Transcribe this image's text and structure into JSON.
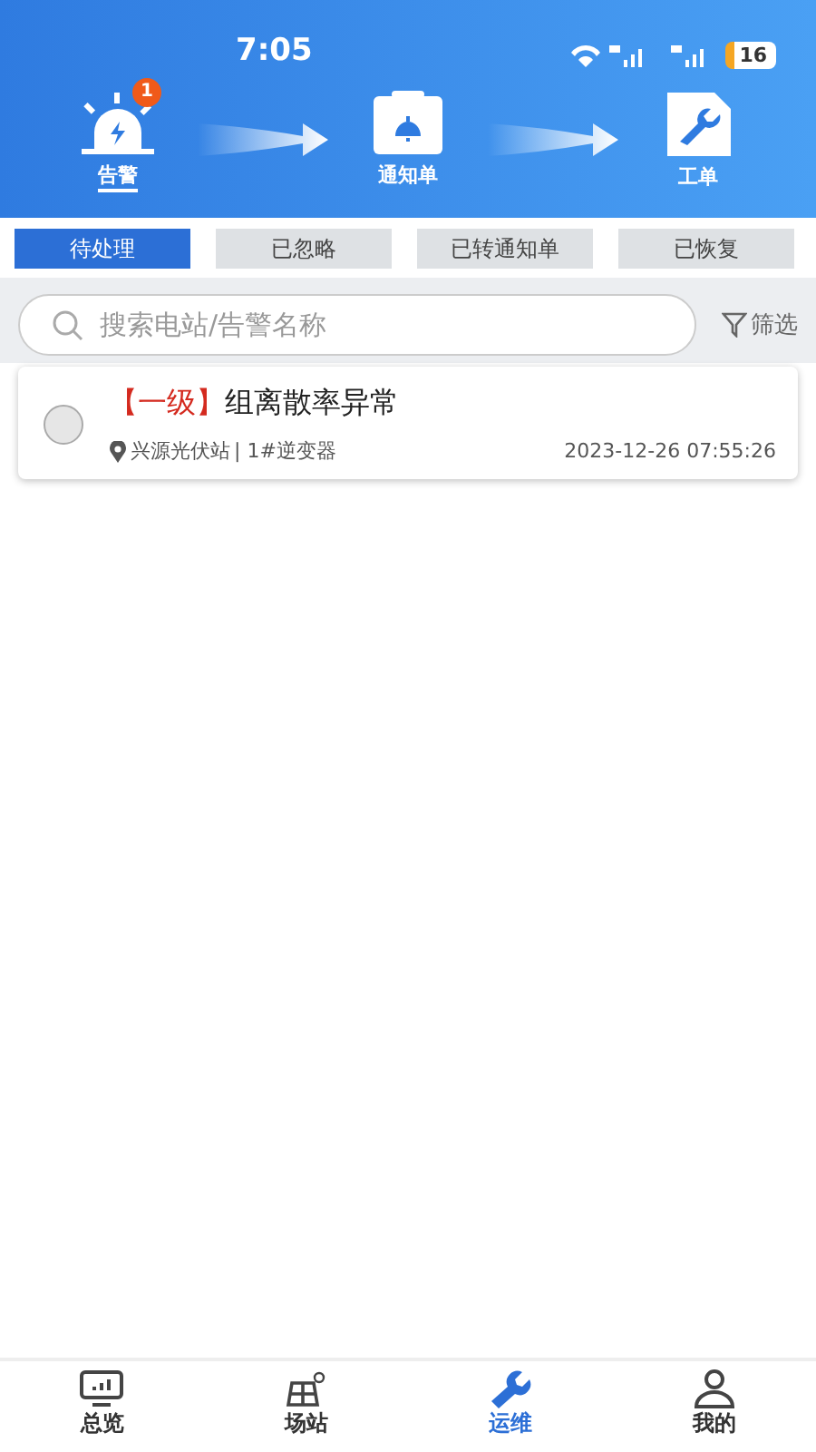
{
  "status_bar": {
    "time": "7:05",
    "battery": "16"
  },
  "flow": [
    {
      "kind": "alarm",
      "label": "告警",
      "selected": true,
      "badge": "1"
    },
    {
      "kind": "notice",
      "label": "通知单",
      "selected": false
    },
    {
      "kind": "order",
      "label": "工单",
      "selected": false
    }
  ],
  "tabs": [
    {
      "label": "待处理",
      "selected": true
    },
    {
      "label": "已忽略",
      "selected": false
    },
    {
      "label": "已转通知单",
      "selected": false
    },
    {
      "label": "已恢复",
      "selected": false
    }
  ],
  "search": {
    "placeholder": "搜索电站/告警名称"
  },
  "filter": "筛选",
  "alarms": [
    {
      "checked": false,
      "level": "【一级】",
      "title": "组离散率异常",
      "station": "兴源光伏站",
      "device": "| 1#逆变器",
      "time": "2023-12-26 07:55:26"
    }
  ],
  "nav": [
    {
      "kind": "overview",
      "label": "总览",
      "selected": false
    },
    {
      "kind": "station",
      "label": "场站",
      "selected": false
    },
    {
      "kind": "ops",
      "label": "运维",
      "selected": true
    },
    {
      "kind": "me",
      "label": "我的",
      "selected": false
    }
  ]
}
